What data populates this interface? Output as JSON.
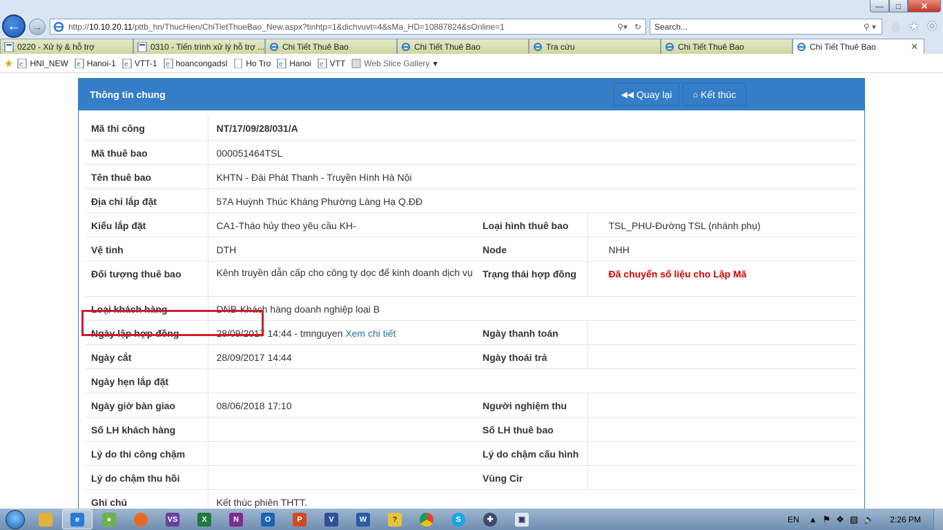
{
  "browser": {
    "url_prefix": "http://",
    "url_host": "10.10.20.11",
    "url_path": "/pttb_hn/ThucHien/ChiTietThueBao_New.aspx?tinhtp=1&dichvuvt=4&sMa_HD=10887824&sOnline=1",
    "search_placeholder": "Search...",
    "tabs": [
      {
        "label": "0220 - Xử lý & hỗ trợ",
        "icon": "doc-icon"
      },
      {
        "label": "0310 - Tiến trình xử lý hỗ trợ ...",
        "icon": "doc-icon"
      },
      {
        "label": "Chi Tiết Thuê Bao",
        "icon": "ie-icon"
      },
      {
        "label": "Chi Tiết Thuê Bao",
        "icon": "ie-icon"
      },
      {
        "label": "Tra cứu",
        "icon": "ie-icon"
      },
      {
        "label": "Chi Tiết Thuê Bao",
        "icon": "ie-icon"
      },
      {
        "label": "Chi Tiết Thuê Bao",
        "icon": "ie-icon",
        "active": true
      }
    ],
    "favorites": [
      "HNI_NEW",
      "Hanoi-1",
      "VTT-1",
      "hoancongadsl",
      "Ho Tro",
      "Hanoi",
      "VTT",
      "Web Slice Gallery"
    ]
  },
  "panel": {
    "title": "Thông tin chung",
    "back_label": "Quay lại",
    "end_label": "Kết thúc"
  },
  "rows": [
    {
      "label": "Mã thi công",
      "value": "NT/17/09/28/031/A"
    },
    {
      "label": "Mã thuê bao",
      "value": "000051464TSL"
    },
    {
      "label": "Tên thuê bao",
      "value": "KHTN - Đài Phát Thanh - Truyền Hình Hà Nội"
    },
    {
      "label": "Địa chỉ lắp đặt",
      "value": "57A Huỳnh Thúc Kháng Phường Láng Hạ Q.ĐĐ"
    },
    {
      "label": "Kiểu lắp đặt",
      "value": "CA1-Tháo hủy theo yêu cầu KH-",
      "label2": "Loại hình thuê bao",
      "value2": "TSL_PHU-Đường TSL (nhánh phụ)"
    },
    {
      "label": "Vệ tinh",
      "value": "DTH",
      "label2": "Node",
      "value2": "NHH"
    },
    {
      "label": "Đối tượng thuê bao",
      "value": "Kênh truyền dẫn cấp cho công ty dọc để kinh doanh dịch vụ",
      "label2": "Trạng thái hợp đồng",
      "value2": "Đã chuyển số liệu cho Lập Mã"
    },
    {
      "label": "Loại khách hàng",
      "value": "DNB-Khách hàng doanh nghiệp loại B"
    },
    {
      "label": "Ngày lập hợp đồng",
      "value": "28/09/2017 14:44 - tmnguyen",
      "link": "Xem chi tiết",
      "label2": "Ngày thanh toán",
      "value2": ""
    },
    {
      "label": "Ngày cắt",
      "value": "28/09/2017 14:44",
      "label2": "Ngày thoái trả",
      "value2": ""
    },
    {
      "label": "Ngày hẹn lắp đặt",
      "value": ""
    },
    {
      "label": "Ngày giờ bàn giao",
      "value": "08/06/2018 17:10",
      "label2": "Người nghiệm thu",
      "value2": ""
    },
    {
      "label": "Số LH khách hàng",
      "value": "",
      "label2": "Số LH thuê bao",
      "value2": ""
    },
    {
      "label": "Lý do thi công chậm",
      "value": "",
      "label2": "Lý do chậm cấu hình",
      "value2": ""
    },
    {
      "label": "Lý do chậm thu hồi",
      "value": "",
      "label2": "Vùng Cir",
      "value2": ""
    },
    {
      "label": "Ghi chú",
      "value": "Kết thúc phiên THTT."
    }
  ],
  "taskbar": {
    "language": "EN",
    "time": "2:26 PM"
  },
  "colors": {
    "panel_header": "#347ec7",
    "status_red": "#d40000",
    "customer_green": "#2e8b2e",
    "link_blue": "#2a6aa8",
    "highlight_red": "#d01c24"
  }
}
